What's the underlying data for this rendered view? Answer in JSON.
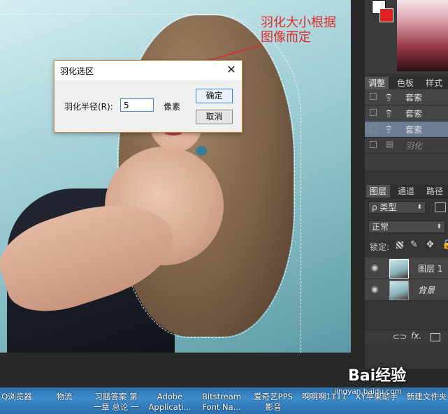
{
  "annotation": {
    "line1": "羽化大小根据",
    "line2": "图像而定"
  },
  "dialog": {
    "title": "羽化选区",
    "close": "✕",
    "label": "羽化半径(R):",
    "value": "5",
    "unit": "像素",
    "ok": "确定",
    "cancel": "取消"
  },
  "panels": {
    "adjust_tabs": [
      "调整",
      "色板",
      "样式"
    ],
    "history_rows": [
      {
        "label": "套索",
        "selected": false
      },
      {
        "label": "套索",
        "selected": false
      },
      {
        "label": "套索",
        "selected": true
      },
      {
        "label": "羽化",
        "selected": false
      }
    ],
    "layer_tabs": [
      "图层",
      "通道",
      "路径"
    ],
    "kind_filter": "ρ 类型",
    "blend_mode": "正常",
    "lock_label": "锁定:",
    "layers": [
      {
        "name": "图层 1"
      },
      {
        "name": "背景"
      }
    ],
    "footer_icons": [
      "link-icon",
      "fx-icon",
      "mask-icon"
    ],
    "fx_label": "fx."
  },
  "taskbar": {
    "items": [
      {
        "text": "Q浏览器",
        "text2": ""
      },
      {
        "text": "物流",
        "text2": ""
      },
      {
        "text": "习题答案 第",
        "text2": "一章 总论 一"
      },
      {
        "text": "Adobe",
        "text2": "Applicati..."
      },
      {
        "text": "Bitstream",
        "text2": "Font Na..."
      },
      {
        "text": "爱奇艺PPS",
        "text2": "影音"
      },
      {
        "text": "啊啊啊1111",
        "text2": ""
      },
      {
        "text": "XY苹果助手",
        "text2": ""
      },
      {
        "text": "新建文件夹",
        "text2": ""
      }
    ]
  },
  "watermark": {
    "brand": "Bai经验",
    "url": "jingyan.baidu.com"
  },
  "colors": {
    "annotation": "#e02a2a",
    "foreground": "#ffffff",
    "background": "#e02020"
  }
}
